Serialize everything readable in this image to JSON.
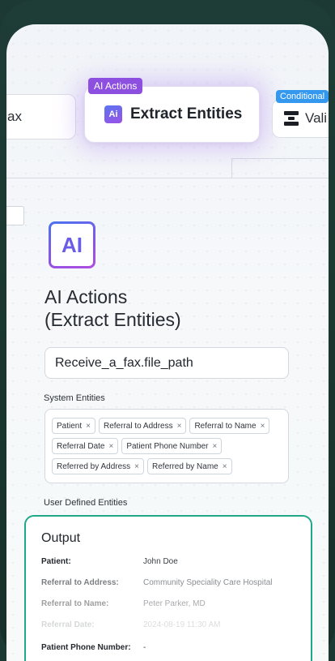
{
  "canvas": {
    "fax_node_label": "ax",
    "extract_tag": "AI Actions",
    "extract_icon": "Ai",
    "extract_title": "Extract Entities",
    "conditional_tag": "Conditional",
    "conditional_node_label": "Vali"
  },
  "panel": {
    "icon_text": "AI",
    "title_line1": "AI Actions",
    "title_line2": "(Extract Entities)",
    "input_value": "Receive_a_fax.file_path",
    "system_entities_label": "System Entities",
    "chips": [
      "Patient",
      "Referral to Address",
      "Referral to Name",
      "Referral Date",
      "Patient Phone Number",
      "Referred by Address",
      "Referred by Name"
    ],
    "chip_remove_glyph": "×",
    "user_defined_label": "User Defined Entities"
  },
  "output": {
    "title": "Output",
    "rows": [
      {
        "key": "Patient:",
        "value": "John Doe"
      },
      {
        "key": "Referral to Address:",
        "value": "Community Speciality Care Hospital"
      },
      {
        "key": "Referral to Name:",
        "value": "Peter Parker, MD"
      },
      {
        "key": "Referral Date:",
        "value": "2024-08-19 11:30 AM"
      },
      {
        "key": "Patient Phone Number:",
        "value": "-"
      }
    ]
  },
  "colors": {
    "ai_purple": "#8d4fe0",
    "conditional_blue": "#3598ef",
    "output_border": "#1fa88a"
  }
}
